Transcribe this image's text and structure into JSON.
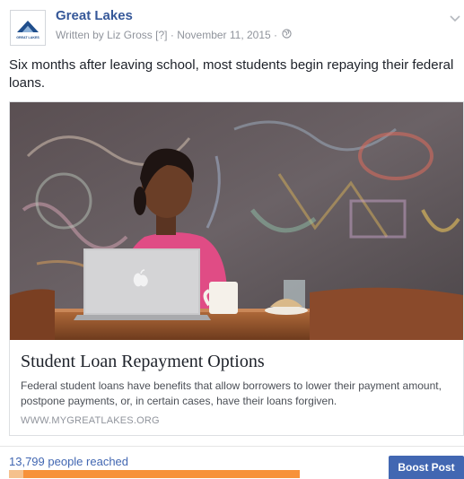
{
  "header": {
    "page_name": "Great Lakes",
    "logo_text": "GREAT LAKES",
    "written_by": "Written by Liz Gross",
    "help_marker": "[?]",
    "separator": "·",
    "date": "November 11, 2015",
    "privacy_icon": "globe-icon",
    "menu_icon": "chevron-down-icon"
  },
  "post": {
    "message": "Six months after leaving school, most students begin repaying their federal loans."
  },
  "link_card": {
    "image": "photo of a student with a laptop at a cafe table",
    "title": "Student Loan Repayment Options",
    "description": "Federal student loans have benefits that allow borrowers to lower their payment amount, postpone payments, or, in certain cases, have their loans forgiven.",
    "url": "WWW.MYGREATLAKES.ORG"
  },
  "footer": {
    "reach_label": "13,799 people reached",
    "boost_label": "Boost Post"
  },
  "colors": {
    "link_blue": "#365899",
    "button_blue": "#4267b2",
    "reach_bar": "#f7923a"
  }
}
